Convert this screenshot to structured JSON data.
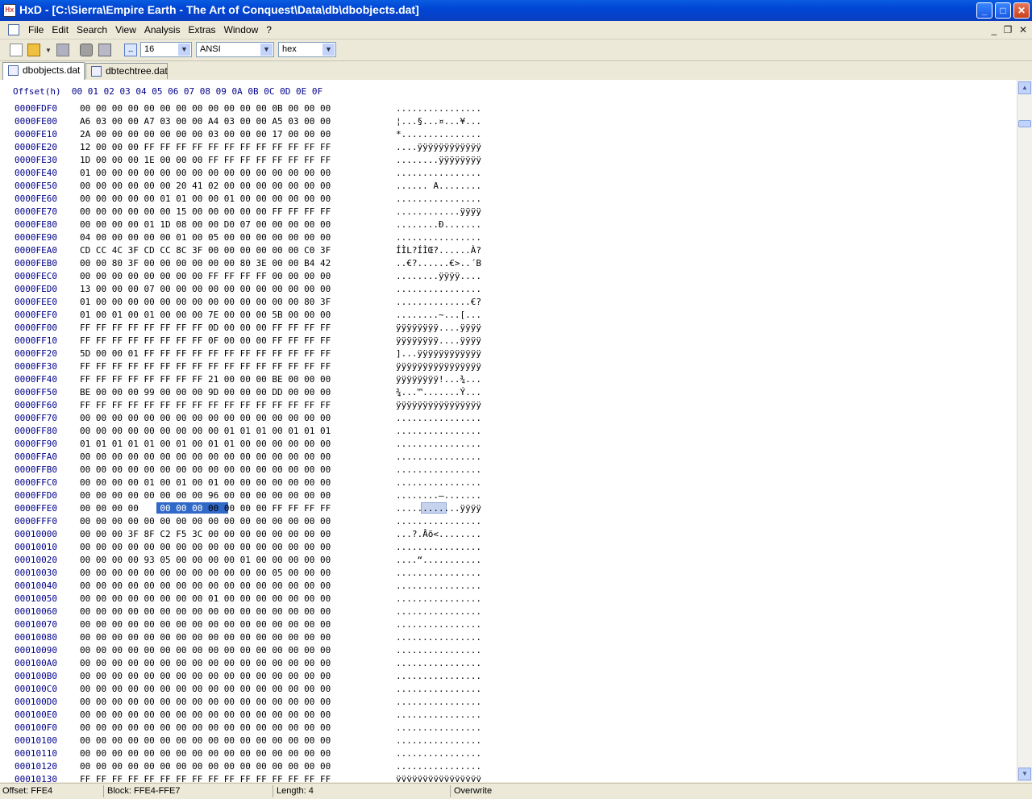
{
  "window": {
    "title": "HxD - [C:\\Sierra\\Empire Earth - The Art of Conquest\\Data\\db\\dbobjects.dat]",
    "app_icon": "hxd-app-icon",
    "minimize": "_",
    "maximize": "□",
    "close": "✕"
  },
  "menu": {
    "items": [
      "File",
      "Edit",
      "Search",
      "View",
      "Analysis",
      "Extras",
      "Window",
      "?"
    ],
    "mdi_minimize": "_",
    "mdi_restore": "❐",
    "mdi_close": "✕"
  },
  "toolbar": {
    "bytes_per_row": "16",
    "charset": "ANSI",
    "offset_base": "hex",
    "icons": [
      "new-file-icon",
      "open-file-icon",
      "save-icon",
      "disk-icon",
      "disk-save-icon",
      "columns-icon"
    ]
  },
  "tabs": [
    {
      "label": "dbobjects.dat",
      "active": true
    },
    {
      "label": "dbtechtree.dat",
      "active": false
    }
  ],
  "hex": {
    "header_offset": "Offset(h)",
    "header_cols": "00 01 02 03 04 05 06 07 08 09 0A 0B 0C 0D 0E 0F",
    "selected_offset": "0000FFE0",
    "selected_hex": "00 00 00 00",
    "rows": [
      {
        "offset": "0000FDF0",
        "hex": "00 00 00 00 00 00 00 00 00 00 00 00 0B 00 00 00",
        "ascii": "................"
      },
      {
        "offset": "0000FE00",
        "hex": "A6 03 00 00 A7 03 00 00 A4 03 00 00 A5 03 00 00",
        "ascii": "¦...§...¤...¥..."
      },
      {
        "offset": "0000FE10",
        "hex": "2A 00 00 00 00 00 00 00 03 00 00 00 17 00 00 00",
        "ascii": "*..............."
      },
      {
        "offset": "0000FE20",
        "hex": "12 00 00 00 FF FF FF FF FF FF FF FF FF FF FF FF",
        "ascii": "....ÿÿÿÿÿÿÿÿÿÿÿÿ"
      },
      {
        "offset": "0000FE30",
        "hex": "1D 00 00 00 1E 00 00 00 FF FF FF FF FF FF FF FF",
        "ascii": "........ÿÿÿÿÿÿÿÿ"
      },
      {
        "offset": "0000FE40",
        "hex": "01 00 00 00 00 00 00 00 00 00 00 00 00 00 00 00",
        "ascii": "................"
      },
      {
        "offset": "0000FE50",
        "hex": "00 00 00 00 00 00 20 41 02 00 00 00 00 00 00 00",
        "ascii": "...... A........"
      },
      {
        "offset": "0000FE60",
        "hex": "00 00 00 00 00 01 01 00 00 01 00 00 00 00 00 00",
        "ascii": "................"
      },
      {
        "offset": "0000FE70",
        "hex": "00 00 00 00 00 00 15 00 00 00 00 00 FF FF FF FF",
        "ascii": "............ÿÿÿÿ"
      },
      {
        "offset": "0000FE80",
        "hex": "00 00 00 00 01 1D 08 00 00 D0 07 00 00 00 00 00",
        "ascii": "........Ð......."
      },
      {
        "offset": "0000FE90",
        "hex": "04 00 00 00 00 00 01 00 05 00 00 00 00 00 00 00",
        "ascii": "................"
      },
      {
        "offset": "0000FEA0",
        "hex": "CD CC 4C 3F CD CC 8C 3F 00 00 00 00 00 00 C0 3F",
        "ascii": "ÍÌL?ÍÌŒ?......À?"
      },
      {
        "offset": "0000FEB0",
        "hex": "00 00 80 3F 00 00 00 00 00 00 80 3E 00 00 B4 42",
        "ascii": "..€?......€>..´B"
      },
      {
        "offset": "0000FEC0",
        "hex": "00 00 00 00 00 00 00 00 FF FF FF FF 00 00 00 00",
        "ascii": "........ÿÿÿÿ...."
      },
      {
        "offset": "0000FED0",
        "hex": "13 00 00 00 07 00 00 00 00 00 00 00 00 00 00 00",
        "ascii": "................"
      },
      {
        "offset": "0000FEE0",
        "hex": "01 00 00 00 00 00 00 00 00 00 00 00 00 00 80 3F",
        "ascii": "..............€?"
      },
      {
        "offset": "0000FEF0",
        "hex": "01 00 01 00 01 00 00 00 7E 00 00 00 5B 00 00 00",
        "ascii": "........~...[..."
      },
      {
        "offset": "0000FF00",
        "hex": "FF FF FF FF FF FF FF FF 0D 00 00 00 FF FF FF FF",
        "ascii": "ÿÿÿÿÿÿÿÿ....ÿÿÿÿ"
      },
      {
        "offset": "0000FF10",
        "hex": "FF FF FF FF FF FF FF FF 0F 00 00 00 FF FF FF FF",
        "ascii": "ÿÿÿÿÿÿÿÿ....ÿÿÿÿ"
      },
      {
        "offset": "0000FF20",
        "hex": "5D 00 00 01 FF FF FF FF FF FF FF FF FF FF FF FF",
        "ascii": "]...ÿÿÿÿÿÿÿÿÿÿÿÿ"
      },
      {
        "offset": "0000FF30",
        "hex": "FF FF FF FF FF FF FF FF FF FF FF FF FF FF FF FF",
        "ascii": "ÿÿÿÿÿÿÿÿÿÿÿÿÿÿÿÿ"
      },
      {
        "offset": "0000FF40",
        "hex": "FF FF FF FF FF FF FF FF 21 00 00 00 BE 00 00 00",
        "ascii": "ÿÿÿÿÿÿÿÿ!...¾..."
      },
      {
        "offset": "0000FF50",
        "hex": "BE 00 00 00 99 00 00 00 9D 00 00 00 DD 00 00 00",
        "ascii": "¾...™.......Ý..."
      },
      {
        "offset": "0000FF60",
        "hex": "FF FF FF FF FF FF FF FF FF FF FF FF FF FF FF FF",
        "ascii": "ÿÿÿÿÿÿÿÿÿÿÿÿÿÿÿÿ"
      },
      {
        "offset": "0000FF70",
        "hex": "00 00 00 00 00 00 00 00 00 00 00 00 00 00 00 00",
        "ascii": "................"
      },
      {
        "offset": "0000FF80",
        "hex": "00 00 00 00 00 00 00 00 00 01 01 01 00 01 01 01",
        "ascii": "................"
      },
      {
        "offset": "0000FF90",
        "hex": "01 01 01 01 01 00 01 00 01 01 00 00 00 00 00 00",
        "ascii": "................"
      },
      {
        "offset": "0000FFA0",
        "hex": "00 00 00 00 00 00 00 00 00 00 00 00 00 00 00 00",
        "ascii": "................"
      },
      {
        "offset": "0000FFB0",
        "hex": "00 00 00 00 00 00 00 00 00 00 00 00 00 00 00 00",
        "ascii": "................"
      },
      {
        "offset": "0000FFC0",
        "hex": "00 00 00 00 01 00 01 00 01 00 00 00 00 00 00 00",
        "ascii": "................"
      },
      {
        "offset": "0000FFD0",
        "hex": "00 00 00 00 00 00 00 00 96 00 00 00 00 00 00 00",
        "ascii": "........–......."
      },
      {
        "offset": "0000FFE0",
        "hex": "00 00 00 00 00 00 00 00 00 00 00 00 FF FF FF FF",
        "ascii": "............ÿÿÿÿ"
      },
      {
        "offset": "0000FFF0",
        "hex": "00 00 00 00 00 00 00 00 00 00 00 00 00 00 00 00",
        "ascii": "................"
      },
      {
        "offset": "00010000",
        "hex": "00 00 00 3F 8F C2 F5 3C 00 00 00 00 00 00 00 00",
        "ascii": "...?.Âõ<........"
      },
      {
        "offset": "00010010",
        "hex": "00 00 00 00 00 00 00 00 00 00 00 00 00 00 00 00",
        "ascii": "................"
      },
      {
        "offset": "00010020",
        "hex": "00 00 00 00 93 05 00 00 00 00 01 00 00 00 00 00",
        "ascii": "....“..........."
      },
      {
        "offset": "00010030",
        "hex": "00 00 00 00 00 00 00 00 00 00 00 00 05 00 00 00",
        "ascii": "................"
      },
      {
        "offset": "00010040",
        "hex": "00 00 00 00 00 00 00 00 00 00 00 00 00 00 00 00",
        "ascii": "................"
      },
      {
        "offset": "00010050",
        "hex": "00 00 00 00 00 00 00 00 01 00 00 00 00 00 00 00",
        "ascii": "................"
      },
      {
        "offset": "00010060",
        "hex": "00 00 00 00 00 00 00 00 00 00 00 00 00 00 00 00",
        "ascii": "................"
      },
      {
        "offset": "00010070",
        "hex": "00 00 00 00 00 00 00 00 00 00 00 00 00 00 00 00",
        "ascii": "................"
      },
      {
        "offset": "00010080",
        "hex": "00 00 00 00 00 00 00 00 00 00 00 00 00 00 00 00",
        "ascii": "................"
      },
      {
        "offset": "00010090",
        "hex": "00 00 00 00 00 00 00 00 00 00 00 00 00 00 00 00",
        "ascii": "................"
      },
      {
        "offset": "000100A0",
        "hex": "00 00 00 00 00 00 00 00 00 00 00 00 00 00 00 00",
        "ascii": "................"
      },
      {
        "offset": "000100B0",
        "hex": "00 00 00 00 00 00 00 00 00 00 00 00 00 00 00 00",
        "ascii": "................"
      },
      {
        "offset": "000100C0",
        "hex": "00 00 00 00 00 00 00 00 00 00 00 00 00 00 00 00",
        "ascii": "................"
      },
      {
        "offset": "000100D0",
        "hex": "00 00 00 00 00 00 00 00 00 00 00 00 00 00 00 00",
        "ascii": "................"
      },
      {
        "offset": "000100E0",
        "hex": "00 00 00 00 00 00 00 00 00 00 00 00 00 00 00 00",
        "ascii": "................"
      },
      {
        "offset": "000100F0",
        "hex": "00 00 00 00 00 00 00 00 00 00 00 00 00 00 00 00",
        "ascii": "................"
      },
      {
        "offset": "00010100",
        "hex": "00 00 00 00 00 00 00 00 00 00 00 00 00 00 00 00",
        "ascii": "................"
      },
      {
        "offset": "00010110",
        "hex": "00 00 00 00 00 00 00 00 00 00 00 00 00 00 00 00",
        "ascii": "................"
      },
      {
        "offset": "00010120",
        "hex": "00 00 00 00 00 00 00 00 00 00 00 00 00 00 00 00",
        "ascii": "................"
      },
      {
        "offset": "00010130",
        "hex": "FF FF FF FF FF FF FF FF FF FF FF FF FF FF FF FF",
        "ascii": "ÿÿÿÿÿÿÿÿÿÿÿÿÿÿÿÿ"
      }
    ]
  },
  "status": {
    "offset": "Offset: FFE4",
    "block": "Block: FFE4-FFE7",
    "length": "Length: 4",
    "mode": "Overwrite"
  },
  "colors": {
    "title_bar": "#0046d5",
    "selection": "#3169c6",
    "offset_text": "#00008b"
  }
}
